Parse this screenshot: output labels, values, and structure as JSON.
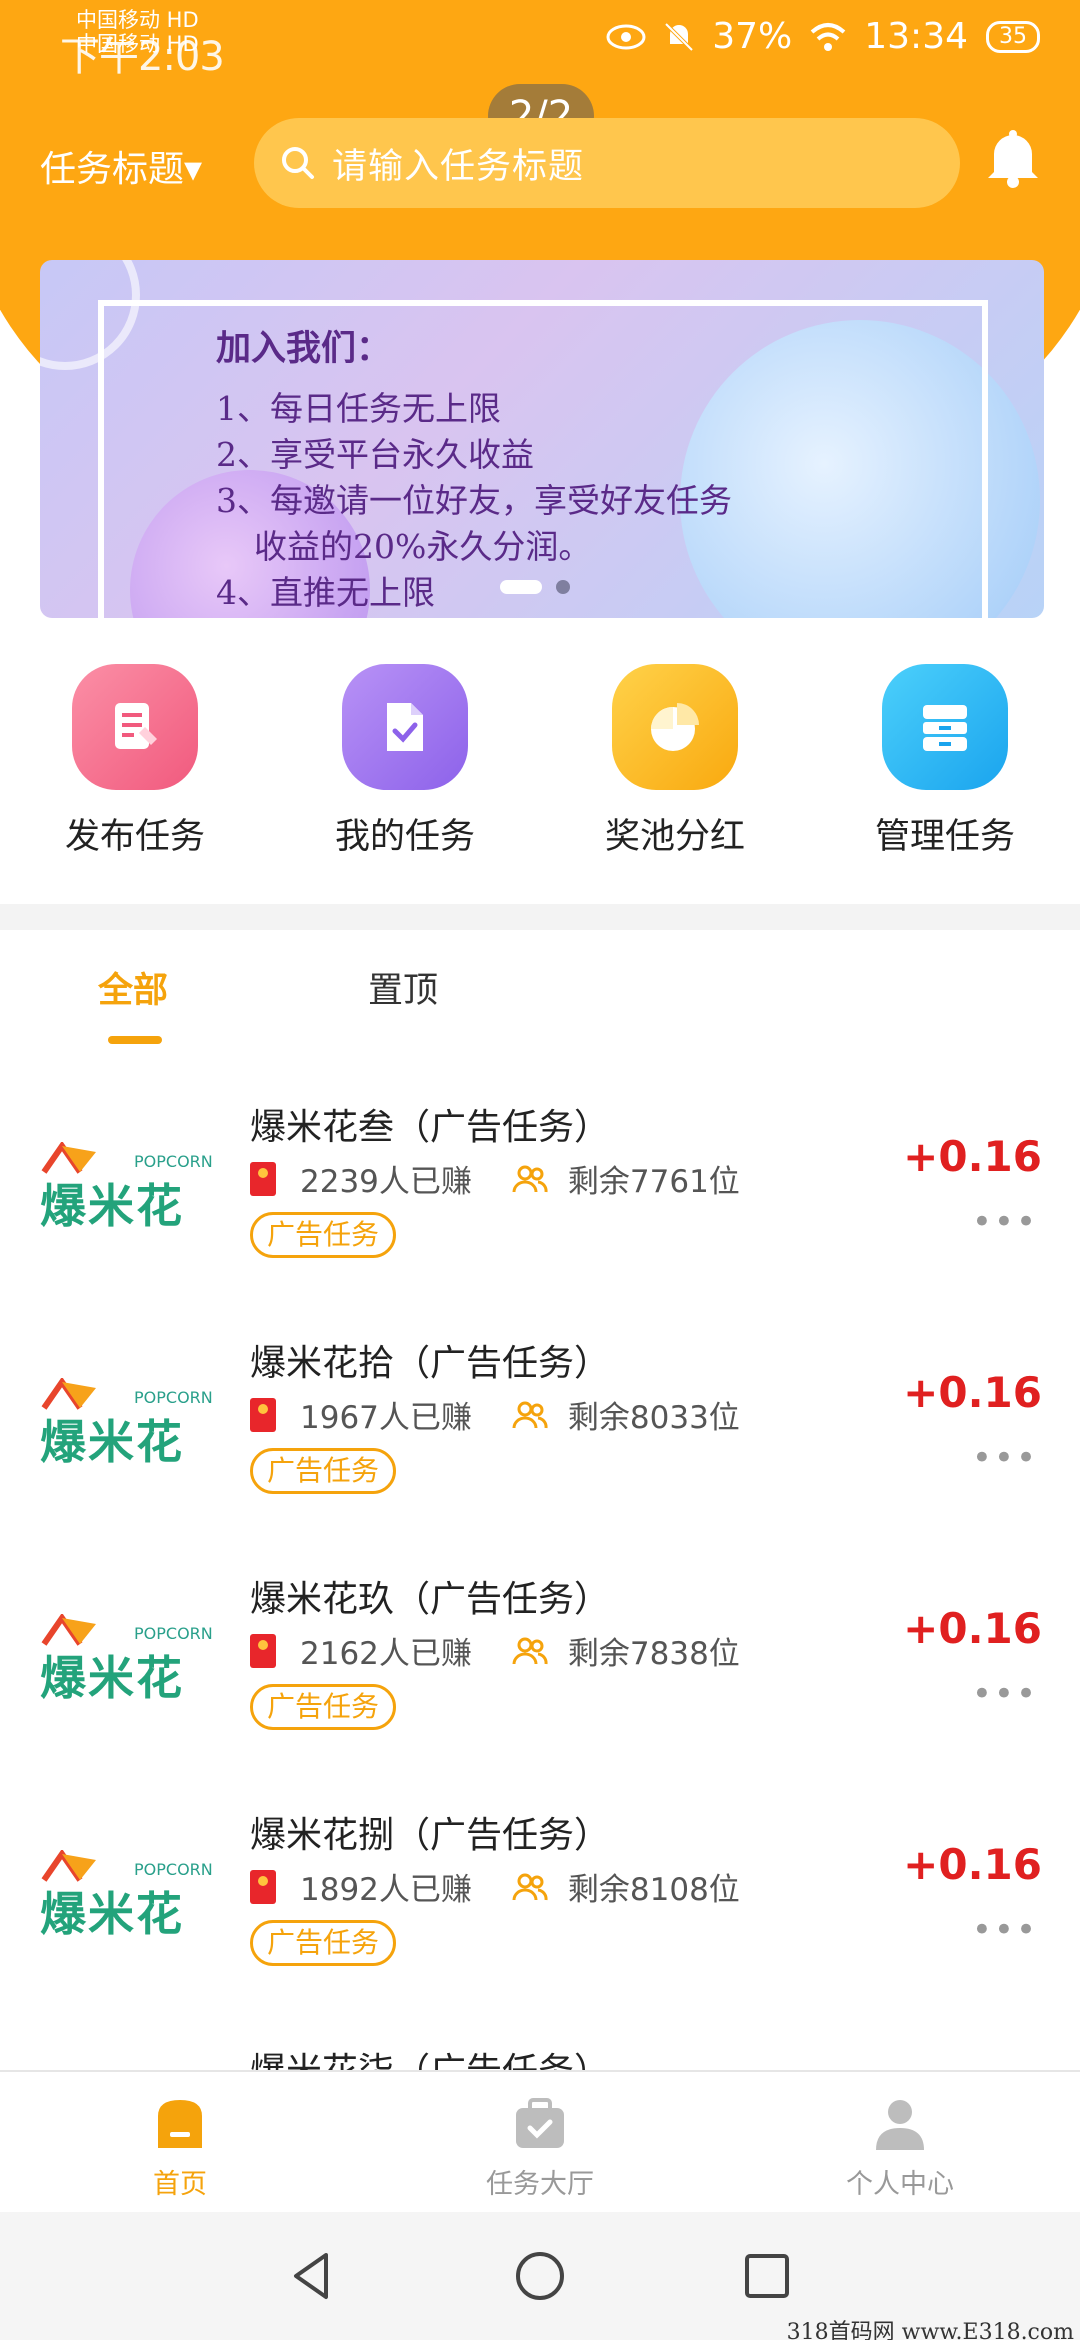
{
  "status_bar": {
    "carrier1": "中国移动 HD",
    "carrier2": "中国移动 HD",
    "time_left": "下午2:03",
    "battery_pct": "37%",
    "time_right": "13:34",
    "battery_level": "35"
  },
  "pager": "2/2",
  "header": {
    "title_dropdown": "任务标题▾",
    "search_placeholder": "请输入任务标题"
  },
  "banner": {
    "heading": "加入我们：",
    "lines": [
      "1、每日任务无上限",
      "2、享受平台永久收益",
      "3、每邀请一位好友，享受好友任务",
      "收益的20%永久分润。",
      "4、直推无上限"
    ]
  },
  "quick_actions": [
    {
      "label": "发布任务",
      "icon": "edit-doc-icon",
      "color": "#f7708f"
    },
    {
      "label": "我的任务",
      "icon": "check-doc-icon",
      "color": "#a37bf0"
    },
    {
      "label": "奖池分红",
      "icon": "pie-chart-icon",
      "color": "#fbbd1c"
    },
    {
      "label": "管理任务",
      "icon": "cabinet-icon",
      "color": "#27b3f0"
    }
  ],
  "tabs": {
    "all": "全部",
    "pinned": "置顶"
  },
  "tasks": [
    {
      "title": "爆米花叁（广告任务）",
      "earned": "2239人已赚",
      "remaining": "剩余7761位",
      "tag": "广告任务",
      "reward": "+0.16"
    },
    {
      "title": "爆米花拾（广告任务）",
      "earned": "1967人已赚",
      "remaining": "剩余8033位",
      "tag": "广告任务",
      "reward": "+0.16"
    },
    {
      "title": "爆米花玖（广告任务）",
      "earned": "2162人已赚",
      "remaining": "剩余7838位",
      "tag": "广告任务",
      "reward": "+0.16"
    },
    {
      "title": "爆米花捌（广告任务）",
      "earned": "1892人已赚",
      "remaining": "剩余8108位",
      "tag": "广告任务",
      "reward": "+0.16"
    }
  ],
  "peek_title": "爆米花柒（广告任务）",
  "logo": {
    "brand_en": "POPCORN",
    "brand_cn": "爆米花"
  },
  "more_glyph": "•••",
  "bottom_nav": {
    "home": "首页",
    "hall": "任务大厅",
    "profile": "个人中心"
  },
  "watermark": "318首码网 www.E318.com",
  "colors": {
    "brand": "#fea712",
    "accent": "#f5a30c",
    "price": "#e02020"
  }
}
